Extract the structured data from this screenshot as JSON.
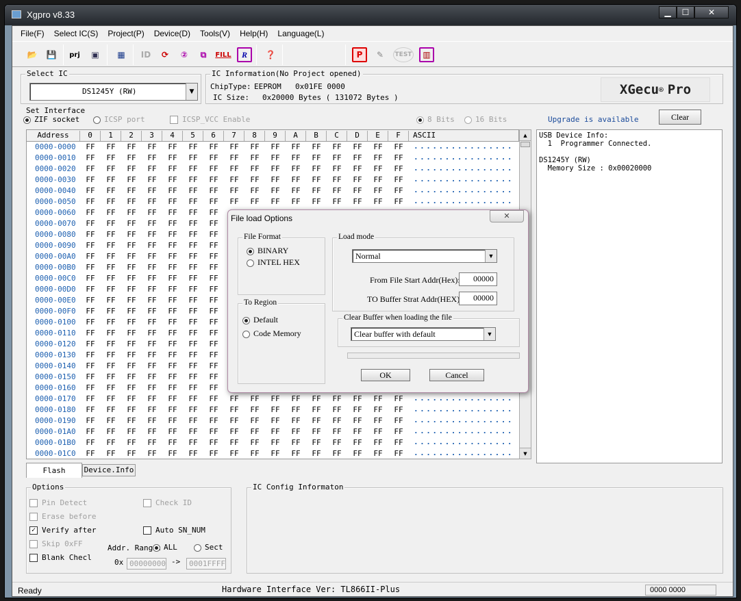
{
  "window": {
    "title": "Xgpro v8.33",
    "minimize": "▁",
    "maximize": "☐",
    "close": "✕"
  },
  "menu": [
    "File(F)",
    "Select IC(S)",
    "Project(P)",
    "Device(D)",
    "Tools(V)",
    "Help(H)",
    "Language(L)"
  ],
  "toolbar": {
    "prj_label": "prj",
    "fill_label": "FILL",
    "test_label": "TEST",
    "r_label": "R",
    "p_label": "P"
  },
  "select_ic": {
    "label": "Select IC",
    "value": "DS1245Y (RW)"
  },
  "ic_info": {
    "label": "IC Information(No Project opened)",
    "chip_type_label": "ChipType:",
    "chip_type": "EEPROM",
    "chip_id": "0x01FE 0000",
    "ic_size_label": "IC Size:",
    "ic_size": "0x20000 Bytes ( 131072 Bytes )"
  },
  "logo": {
    "brand": "XGecu",
    "reg": "®",
    "suffix": "Pro"
  },
  "interface": {
    "label": "Set Interface",
    "zif": "ZIF socket",
    "icsp": "ICSP port",
    "icsp_vcc": "ICSP_VCC Enable",
    "bits8": "8 Bits",
    "bits16": "16 Bits",
    "upgrade": "Upgrade is available",
    "clear": "Clear"
  },
  "hex": {
    "headers": [
      "Address",
      "0",
      "1",
      "2",
      "3",
      "4",
      "5",
      "6",
      "7",
      "8",
      "9",
      "A",
      "B",
      "C",
      "D",
      "E",
      "F",
      "ASCII"
    ],
    "addresses": [
      "0000-0000",
      "0000-0010",
      "0000-0020",
      "0000-0030",
      "0000-0040",
      "0000-0050",
      "0000-0060",
      "0000-0070",
      "0000-0080",
      "0000-0090",
      "0000-00A0",
      "0000-00B0",
      "0000-00C0",
      "0000-00D0",
      "0000-00E0",
      "0000-00F0",
      "0000-0100",
      "0000-0110",
      "0000-0120",
      "0000-0130",
      "0000-0140",
      "0000-0150",
      "0000-0160",
      "0000-0170",
      "0000-0180",
      "0000-0190",
      "0000-01A0",
      "0000-01B0",
      "0000-01C0"
    ],
    "byte_value": "FF",
    "ascii": "................"
  },
  "device_info": {
    "lines": [
      "USB Device Info:",
      "  1  Programmer Connected.",
      "",
      "DS1245Y (RW)",
      "  Memory Size : 0x00020000"
    ]
  },
  "tabs": {
    "flash": "Flash",
    "device_info": "Device.Info"
  },
  "options": {
    "label": "Options",
    "pin_detect": "Pin Detect",
    "check_id": "Check ID",
    "erase_before": "Erase before",
    "verify_after": "Verify after",
    "auto_sn": "Auto SN_NUM",
    "skip_0xff": "Skip 0xFF",
    "blank_check": "Blank Checl",
    "addr_range": "Addr. Range:",
    "all": "ALL",
    "sect": "Sect",
    "ox": "0x",
    "from": "00000000",
    "arrow": "->",
    "to": "0001FFFF"
  },
  "ic_config": {
    "label": "IC Config Informaton"
  },
  "status": {
    "left": "Ready",
    "center": "Hardware Interface Ver: TL866II-Plus",
    "right": "0000 0000"
  },
  "dialog": {
    "title": "File load Options",
    "close": "✕",
    "file_format_label": "File Format",
    "binary": "BINARY",
    "intel_hex": "INTEL HEX",
    "to_region_label": "To Region",
    "default": "Default",
    "code_memory": "Code Memory",
    "load_mode_label": "Load mode",
    "load_mode_value": "Normal",
    "from_file_label": "From File Start Addr(Hex):",
    "from_file_value": "00000",
    "to_buffer_label": "TO Buffer Strat Addr(HEX):",
    "to_buffer_value": "00000",
    "clear_buffer_label": "Clear Buffer when loading the file",
    "clear_buffer_value": "Clear buffer with default",
    "ok": "OK",
    "cancel": "Cancel"
  }
}
